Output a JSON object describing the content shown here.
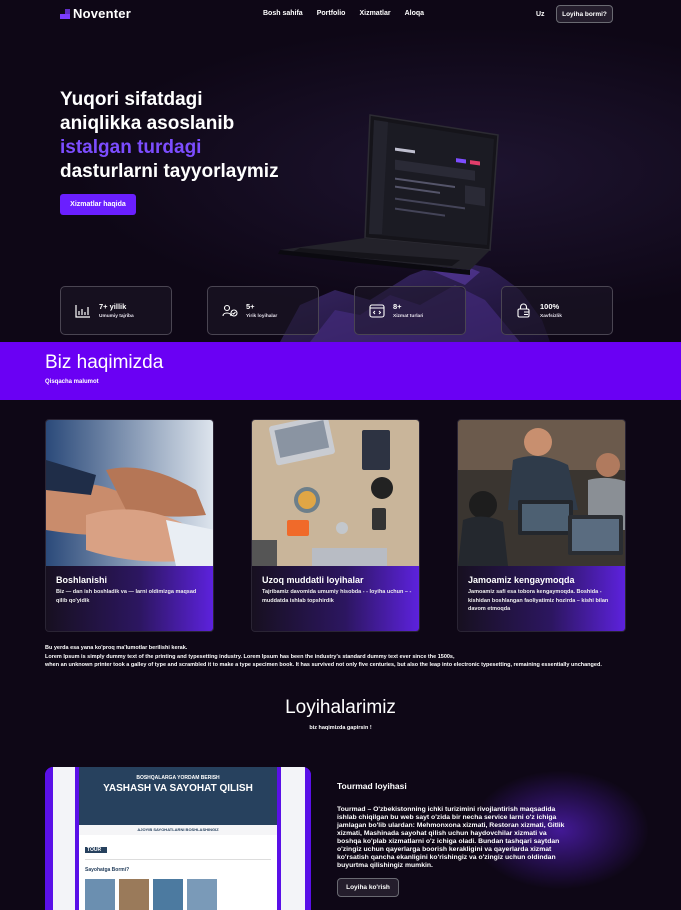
{
  "brand": {
    "name": "Noventer",
    "accent": "#6a00f4"
  },
  "nav": {
    "items": [
      "Bosh sahifa",
      "Portfolio",
      "Xizmatlar",
      "Aloqa"
    ],
    "lang": "Uz",
    "cta": "Loyiha bormi?"
  },
  "hero": {
    "line1": "Yuqori sifatdagi",
    "line2": "aniqlikka asoslanib",
    "line3": "istalgan turdagi",
    "line4": "dasturlarni tayyorlaymiz",
    "button": "Xizmatlar haqida"
  },
  "stats": [
    {
      "value": "7+ yillik",
      "label": "Umumiy tajriba",
      "icon": "chart-icon"
    },
    {
      "value": "5+",
      "label": "Yirik loyihalar",
      "icon": "users-icon"
    },
    {
      "value": "8+",
      "label": "Xizmat turlari",
      "icon": "code-icon"
    },
    {
      "value": "100%",
      "label": "Xavfsizlik",
      "icon": "lock-icon"
    }
  ],
  "about": {
    "title": "Biz haqimizda",
    "subtitle": "Qisqacha malumot"
  },
  "cards": [
    {
      "title": "Boshlanishi",
      "desc": "Biz — dan ish boshladik va — larni oldimizga maqsad qilib qo'yidik"
    },
    {
      "title": "Uzoq muddatli loyihalar",
      "desc": "Tajribamiz davomida umumiy hisobda - - loyiha uchun – - muddatda ishlab topshirdik"
    },
    {
      "title": "Jamoamiz kengaymoqda",
      "desc": "Jamoamiz safi esa tobora kengaymoqda. Boshida - kishidan boshlangan faoliyatimiz hozirda – kishi bilan davom etmoqda"
    }
  ],
  "lorem": {
    "line1": "Bu yerda esa yana ko'proq ma'lumotlar berilishi kerak.",
    "line2": "Lorem Ipsum is simply dummy text of the printing and typesetting industry. Lorem Ipsum has been the industry's standard dummy text ever since the 1500s,",
    "line3": "when an unknown printer took a galley of type and scrambled it to make a type specimen book. It has survived not only five centuries, but also the leap into electronic typesetting, remaining essentially unchanged."
  },
  "projects": {
    "title": "Loyihalarimiz",
    "subtitle": "biz haqimizda gapirsin !",
    "item": {
      "name": "Tourmad loyihasi",
      "desc": "Tourmad – O'zbekistonning ichki turizimini rivojlantirish maqsadida ishlab chiqilgan bu web sayt o'zida bir necha service larni o'z ichiga jamlagan bo'lib ulardan: Mehmonxona xizmati, Restoran xizmati, Gitlik xizmati, Mashinada sayohat qilish uchun haydovchilar xizmati va boshqa ko'plab xizmatlarni o'z ichiga oladi. Bundan tashqari saytdan o'zingiz uchun qayerlarga boorish kerakligini va qayerlarda xizmat ko'rsatish qancha ekanligini ko'rishingiz va o'zingiz uchun oldindan buyurtma qilishingiz mumkin.",
      "button": "Loyiha ko'rish",
      "screenshot": {
        "banner_top": "BOSHQALARGA YORDAM BERISH",
        "banner_main": "YASHASH VA SAYOHAT QILISH",
        "section": "AJOYIB SAYOHATLARNI BOSHLASHINGIZ",
        "logo": "TOUR",
        "subhead": "Sayohatga Bormi?"
      }
    }
  }
}
